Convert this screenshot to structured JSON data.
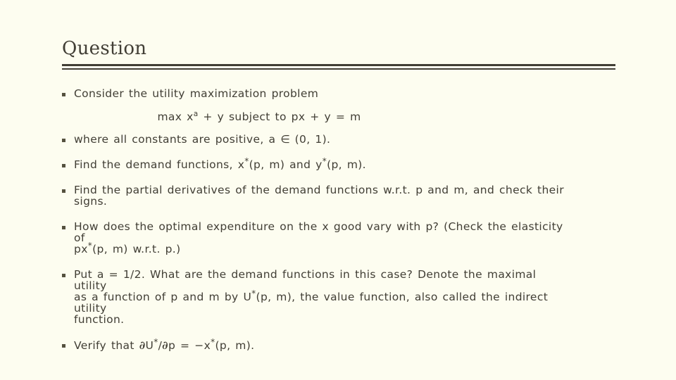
{
  "slide": {
    "title": "Question",
    "background_color": "#fdfdf0",
    "text_color": "#413e35",
    "rule_color": "#413e35",
    "bullet_marker_color": "#55513f"
  },
  "bullets": [
    {
      "id": "consider",
      "lines": [
        "Consider the utility maximization problem"
      ]
    },
    {
      "id": "where-constants",
      "lines": [
        "where all constants are positive, a ∈ (0, 1)."
      ],
      "prefix": "where all constants are positive, a ",
      "symbol": "∈",
      "suffix": " (0, 1)."
    },
    {
      "id": "find-demand",
      "lines": [
        "Find the demand functions, x*(p, m) and y*(p, m)."
      ],
      "segments": [
        "Find the demand functions, x",
        "*",
        "(p, m) and y",
        "*",
        "(p, m)."
      ]
    },
    {
      "id": "find-partials",
      "lines": [
        "Find the partial derivatives of the demand functions w.r.t. p and m, and check their",
        "signs."
      ]
    },
    {
      "id": "optimal-expenditure",
      "lines": [
        "How does the optimal expenditure on the x good vary with p? (Check the elasticity",
        "of",
        "px*(p, m) w.r.t. p.)"
      ],
      "last_line_segments": [
        "px",
        "*",
        "(p, m) w.r.t. p.)"
      ]
    },
    {
      "id": "put-a-half",
      "lines": [
        "Put a = 1/2. What are the demand functions in this case? Denote the maximal",
        "utility",
        "as a function of p and m by U*(p, m), the value function, also called the indirect",
        "utility",
        "function."
      ],
      "line3_segments": [
        "as a function of p and m  by U",
        "*",
        "(p, m), the value function, also called the indirect"
      ]
    },
    {
      "id": "verify",
      "lines": [
        "Verify that ∂U*/∂p = −x*(p, m)."
      ],
      "segments": [
        "Verify that ",
        "∂",
        "U",
        "*",
        "/",
        "∂",
        "p = −x",
        "*",
        "(p, m)."
      ]
    }
  ],
  "equation": {
    "id": "max-problem",
    "prefix": "max x",
    "exponent": "a",
    "suffix": " + y subject to px + y = m",
    "full": "max xᵃ + y subject to px + y = m"
  }
}
